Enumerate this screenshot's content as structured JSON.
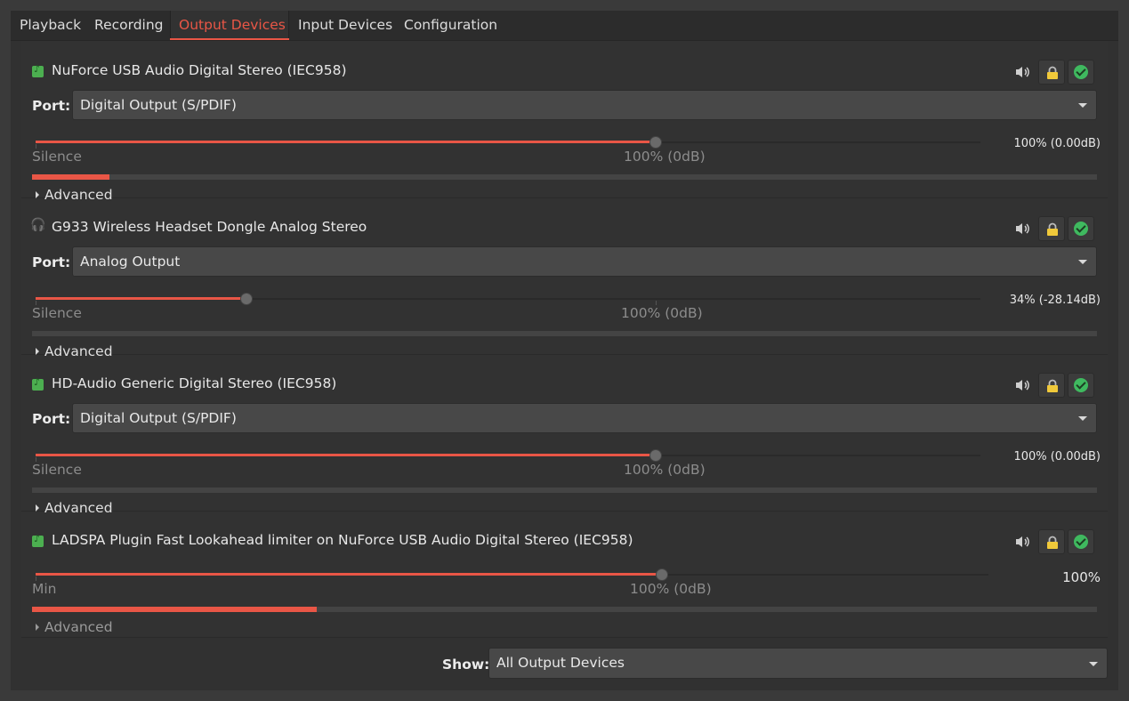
{
  "tabs": [
    {
      "label": "Playback"
    },
    {
      "label": "Recording"
    },
    {
      "label": "Output Devices"
    },
    {
      "label": "Input Devices"
    },
    {
      "label": "Configuration"
    }
  ],
  "active_tab": "Output Devices",
  "port_label": "Port:",
  "devices": [
    {
      "name": "NuForce USB Audio Digital Stereo (IEC958)",
      "icon": "audio-card-icon",
      "port": "Digital Output (S/PDIF)",
      "volume_fraction": 1.0,
      "volume_text": "100% (0.00dB)",
      "min_label": "Silence",
      "mark_label": "100% (0dB)",
      "meter_fraction": 0.073,
      "advanced_label": "Advanced"
    },
    {
      "name": "G933 Wireless Headset Dongle Analog Stereo",
      "icon": "headset-icon",
      "port": "Analog Output",
      "volume_fraction": 0.34,
      "volume_text": "34% (-28.14dB)",
      "min_label": "Silence",
      "mark_label": "100% (0dB)",
      "meter_fraction": 0.0,
      "advanced_label": "Advanced"
    },
    {
      "name": "HD-Audio Generic Digital Stereo (IEC958)",
      "icon": "audio-card-icon",
      "port": "Digital Output (S/PDIF)",
      "volume_fraction": 1.0,
      "volume_text": "100% (0.00dB)",
      "min_label": "Silence",
      "mark_label": "100% (0dB)",
      "meter_fraction": 0.0,
      "advanced_label": "Advanced"
    },
    {
      "name": "LADSPA Plugin Fast Lookahead limiter on NuForce USB Audio Digital Stereo (IEC958)",
      "icon": "audio-card-icon",
      "volume_fraction": 1.0,
      "volume_text": "100%",
      "min_label": "Min",
      "mark_label": "100% (0dB)",
      "meter_fraction": 0.267,
      "advanced_label": "Advanced"
    }
  ],
  "show": {
    "label": "Show:",
    "value": "All Output Devices"
  },
  "colors": {
    "accent": "#e95646",
    "background": "#313131",
    "check": "#3fb95f",
    "lock": "#f0c93a"
  }
}
